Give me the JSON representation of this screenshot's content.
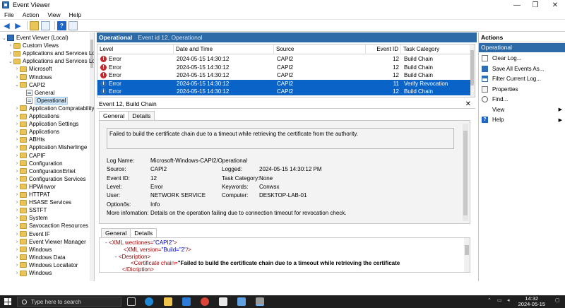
{
  "window": {
    "title": "Event Viewer",
    "controls": {
      "minimize": "—",
      "maximize": "❐",
      "close": "✕"
    }
  },
  "menu": [
    "File",
    "Action",
    "View",
    "Help"
  ],
  "tree": [
    {
      "label": "Event Viewer (Local)",
      "level": 0,
      "exp": "⌄",
      "icon": "ev"
    },
    {
      "label": "Custom Views",
      "level": 1,
      "exp": "›",
      "icon": "folder"
    },
    {
      "label": "Applications and Services Logs",
      "level": 1,
      "exp": "›",
      "icon": "folder"
    },
    {
      "label": "Applications and Services Logs",
      "level": 1,
      "exp": "⌄",
      "icon": "folder"
    },
    {
      "label": "Microsoft",
      "level": 2,
      "exp": "›",
      "icon": "folder"
    },
    {
      "label": "Windows",
      "level": 2,
      "exp": "›",
      "icon": "folder"
    },
    {
      "label": "CAPI2",
      "level": 2,
      "exp": "⌄",
      "icon": "folder"
    },
    {
      "label": "General",
      "level": 3,
      "exp": "",
      "icon": "log"
    },
    {
      "label": "Operational",
      "level": 3,
      "exp": "",
      "icon": "log",
      "selected": true
    },
    {
      "label": "Application Compratability",
      "level": 2,
      "exp": "›",
      "icon": "folder"
    },
    {
      "label": "Applications",
      "level": 2,
      "exp": "›",
      "icon": "folder"
    },
    {
      "label": "Application Settings",
      "level": 2,
      "exp": "›",
      "icon": "folder"
    },
    {
      "label": "Applications",
      "level": 2,
      "exp": "›",
      "icon": "folder"
    },
    {
      "label": "ABHts",
      "level": 2,
      "exp": "›",
      "icon": "folder"
    },
    {
      "label": "Application Misherlinge",
      "level": 2,
      "exp": "›",
      "icon": "folder"
    },
    {
      "label": "CAPIF",
      "level": 2,
      "exp": "›",
      "icon": "folder"
    },
    {
      "label": "Configuration",
      "level": 2,
      "exp": "›",
      "icon": "folder"
    },
    {
      "label": "ConfigurationErliet",
      "level": 2,
      "exp": "›",
      "icon": "folder"
    },
    {
      "label": "Configuration Services",
      "level": 2,
      "exp": "›",
      "icon": "folder"
    },
    {
      "label": "HPWinwor",
      "level": 2,
      "exp": "›",
      "icon": "folder"
    },
    {
      "label": "HTTPAT",
      "level": 2,
      "exp": "›",
      "icon": "folder"
    },
    {
      "label": "HSASE Services",
      "level": 2,
      "exp": "›",
      "icon": "folder"
    },
    {
      "label": "SSTFT",
      "level": 2,
      "exp": "›",
      "icon": "folder"
    },
    {
      "label": "System",
      "level": 2,
      "exp": "›",
      "icon": "folder"
    },
    {
      "label": "Savocaction Resources",
      "level": 2,
      "exp": "›",
      "icon": "folder"
    },
    {
      "label": "Event IF",
      "level": 2,
      "exp": "›",
      "icon": "folder"
    },
    {
      "label": "Event Viewer Manager",
      "level": 2,
      "exp": "›",
      "icon": "folder"
    },
    {
      "label": "Windows",
      "level": 2,
      "exp": "›",
      "icon": "folder"
    },
    {
      "label": "Windows Data",
      "level": 2,
      "exp": "›",
      "icon": "folder"
    },
    {
      "label": "Windows Locallator",
      "level": 2,
      "exp": "›",
      "icon": "folder"
    },
    {
      "label": "Windows",
      "level": 2,
      "exp": "›",
      "icon": "folder"
    }
  ],
  "center_header": {
    "log": "Operational",
    "info": "Event id 12, Operational"
  },
  "columns": {
    "level": "Level",
    "date": "Date and Time",
    "source": "Source",
    "event_id": "Event ID",
    "task": "Task Category"
  },
  "events": [
    {
      "level": "Error",
      "date": "2024-05-15 14:30:12",
      "source": "CAPI2",
      "event_id": "12",
      "task": "Build Chain",
      "icon": "error",
      "selected": false
    },
    {
      "level": "Error",
      "date": "2024-05-15 14:30:12",
      "source": "CAPI2",
      "event_id": "12",
      "task": "Build Chain",
      "icon": "error",
      "selected": false
    },
    {
      "level": "Error",
      "date": "2024-05-15 14:30:12",
      "source": "CAPI2",
      "event_id": "12",
      "task": "Build Chain",
      "icon": "error",
      "selected": false
    },
    {
      "level": "Error",
      "date": "2024-05-15 14:30:12",
      "source": "CAPI2",
      "event_id": "11",
      "task": "Verify Revocation",
      "icon": "info",
      "selected": true
    },
    {
      "level": "Error",
      "date": "2024-05-15 14:30:12",
      "source": "CAPI2",
      "event_id": "12",
      "task": "Build Chain",
      "icon": "info",
      "selected": true
    }
  ],
  "detail": {
    "title": "Event 12, Build Chain",
    "close": "✕",
    "tabs": [
      "General",
      "Details"
    ],
    "description": "Failed to build the certificate chain due to a timeout while retrieving the certificate from the authority.",
    "log_name_label": "Log Name:",
    "log_name": "Microsoft-Windows-CAPI2/Operational",
    "source_label": "Source:",
    "source": "CAPI2",
    "logged_label": "Logged:",
    "logged": "2024-05-15 14:30:12 PM",
    "event_id_label": "Event ID:",
    "event_id": "12",
    "task_label": "Task Category:",
    "task": "None",
    "level_label": "Level:",
    "level": "Error",
    "keywords_label": "Keywords:",
    "keywords": "Conwsx",
    "user_label": "User:",
    "user": "NETWORK SERVICE",
    "computer_label": "Computer:",
    "computer": "DESKTOP-LAB-01",
    "opcode_label": "Optionős:",
    "opcode": "Info",
    "more_label": "More infomation:",
    "more": "Details on the operation failing due to connection timeout for revocation check."
  },
  "xml": {
    "tabs": [
      "General",
      "Details"
    ],
    "line1_minus": "-",
    "line1_open": "<XML",
    "line1_attr": " wectiones=",
    "line1_val": "\"CAPI2\"",
    "line1_close": ">",
    "line2_open": "<XML",
    "line2_attr": " version=",
    "line2_val": "\"Build=\"2\"",
    "line2_close": "/>",
    "line3_minus": "-",
    "line3_tag": "<Desription>",
    "line4_open": "<Certificate",
    "line4_attr": " chain=",
    "line4_val": "\"Failed to build the certificate chain due to a timeout while retrieving the certificate",
    "line5_tag": "</Dicription>"
  },
  "actions": {
    "title": "Actions",
    "section": "Operational",
    "items": [
      {
        "label": "Clear Log...",
        "icon": "doc",
        "arrow": ""
      },
      {
        "label": "Save All Events As...",
        "icon": "save",
        "arrow": ""
      },
      {
        "label": "Filter Current Log...",
        "icon": "filter",
        "arrow": ""
      },
      {
        "label": "Properties",
        "icon": "props",
        "arrow": ""
      },
      {
        "label": "Find...",
        "icon": "find",
        "arrow": ""
      },
      {
        "label": "View",
        "icon": "none",
        "arrow": "▶"
      },
      {
        "label": "Help",
        "icon": "help",
        "arrow": "▶"
      }
    ]
  },
  "taskbar": {
    "search": "Type here to search",
    "time": "14:32",
    "date": "2024-05-15"
  }
}
